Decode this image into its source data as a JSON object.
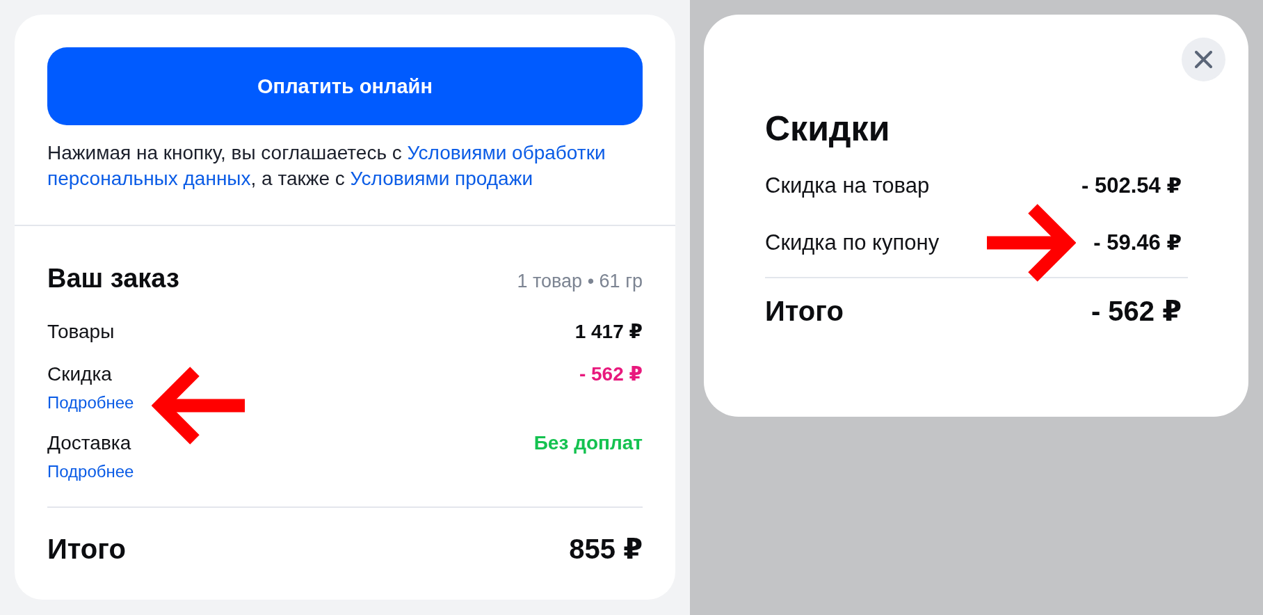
{
  "pay_button": {
    "label": "Оплатить онлайн"
  },
  "consent": {
    "parts": [
      {
        "kind": "text",
        "text": "Нажимая на кнопку, вы соглашаетесь с "
      },
      {
        "kind": "link",
        "text": "Условиями обработки"
      },
      {
        "kind": "link",
        "text": "персональных данных"
      },
      {
        "kind": "text",
        "text": ", а также с "
      },
      {
        "kind": "link",
        "text": "Условиями продажи"
      }
    ]
  },
  "order": {
    "title": "Ваш заказ",
    "summary": "1 товар • 61 гр",
    "rows": [
      {
        "label": "Товары",
        "value": "1 417 ₽",
        "kind": "plain"
      },
      {
        "label": "Скидка",
        "value": "- 562 ₽",
        "kind": "discount",
        "details_link": "Подробнее"
      },
      {
        "label": "Доставка",
        "value": "Без доплат",
        "kind": "free",
        "details_link": "Подробнее"
      }
    ],
    "total": {
      "label": "Итого",
      "value": "855 ₽"
    }
  },
  "discounts_dialog": {
    "title": "Скидки",
    "rows": [
      {
        "label": "Скидка на товар",
        "value": "- 502.54 ₽"
      },
      {
        "label": "Скидка по купону",
        "value": "- 59.46 ₽"
      }
    ],
    "total": {
      "label": "Итого",
      "value": "- 562 ₽"
    }
  }
}
